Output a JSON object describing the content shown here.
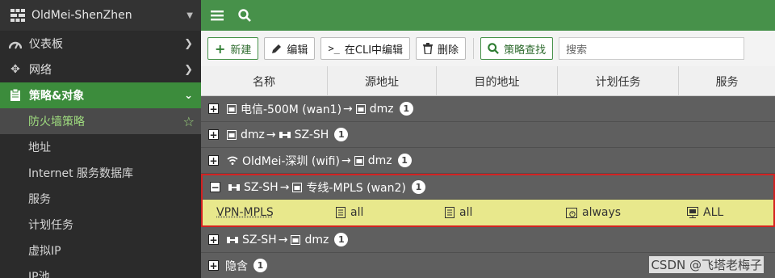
{
  "sidebar": {
    "device_name": "OldMei-ShenZhen",
    "items": [
      {
        "label": "仪表板"
      },
      {
        "label": "网络"
      },
      {
        "label": "策略&对象"
      }
    ],
    "subitems": [
      {
        "label": "防火墙策略"
      },
      {
        "label": "地址"
      },
      {
        "label": "Internet 服务数据库"
      },
      {
        "label": "服务"
      },
      {
        "label": "计划任务"
      },
      {
        "label": "虚拟IP"
      },
      {
        "label": "IP池"
      }
    ]
  },
  "toolbar": {
    "new_label": "新建",
    "edit_label": "编辑",
    "cli_edit_label": "在CLI中编辑",
    "delete_label": "删除",
    "policy_lookup_label": "策略查找",
    "search_placeholder": "搜索"
  },
  "table": {
    "columns": [
      "名称",
      "源地址",
      "目的地址",
      "计划任务",
      "服务"
    ],
    "groups": [
      {
        "src": "电信-500M (wan1)",
        "arrow": "→",
        "dst": "dmz",
        "count": "1",
        "expanded": false
      },
      {
        "src": "dmz",
        "arrow": "→",
        "dst": "SZ-SH",
        "count": "1",
        "expanded": false
      },
      {
        "src": "OldMei-深圳 (wifi)",
        "arrow": "→",
        "dst": "dmz",
        "count": "1",
        "expanded": false
      },
      {
        "src": "SZ-SH",
        "arrow": "→",
        "dst": "专线-MPLS (wan2)",
        "count": "1",
        "expanded": true
      },
      {
        "src": "SZ-SH",
        "arrow": "→",
        "dst": "dmz",
        "count": "1",
        "expanded": false
      },
      {
        "src": "隐含",
        "arrow": "",
        "dst": "",
        "count": "1",
        "expanded": false
      }
    ],
    "policy": {
      "name": "VPN-MPLS",
      "source": "all",
      "destination": "all",
      "schedule": "always",
      "service": "ALL"
    }
  },
  "watermark": "CSDN @飞塔老梅子",
  "colors": {
    "accent_green": "#47914a",
    "group_row": "#5f5f5f",
    "highlight_row": "#e8e88c",
    "highlight_border": "#d32222"
  }
}
